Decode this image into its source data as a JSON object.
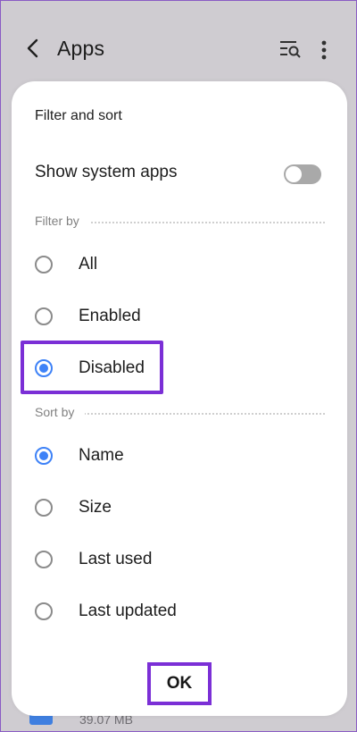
{
  "appbar": {
    "title": "Apps"
  },
  "background": {
    "visible_size": "39.07 MB"
  },
  "dialog": {
    "title": "Filter and sort",
    "show_system_apps_label": "Show system apps",
    "show_system_apps_enabled": false,
    "filter_section_label": "Filter by",
    "filter_options": [
      {
        "label": "All",
        "selected": false
      },
      {
        "label": "Enabled",
        "selected": false
      },
      {
        "label": "Disabled",
        "selected": true
      }
    ],
    "sort_section_label": "Sort by",
    "sort_options": [
      {
        "label": "Name",
        "selected": true
      },
      {
        "label": "Size",
        "selected": false
      },
      {
        "label": "Last used",
        "selected": false
      },
      {
        "label": "Last updated",
        "selected": false
      }
    ],
    "ok_label": "OK"
  },
  "colors": {
    "accent": "#3e82f7",
    "highlight": "#7b2fd6",
    "backdrop": "#cfccd1"
  },
  "icons": [
    "back-icon",
    "search-list-icon",
    "more-options-icon"
  ]
}
